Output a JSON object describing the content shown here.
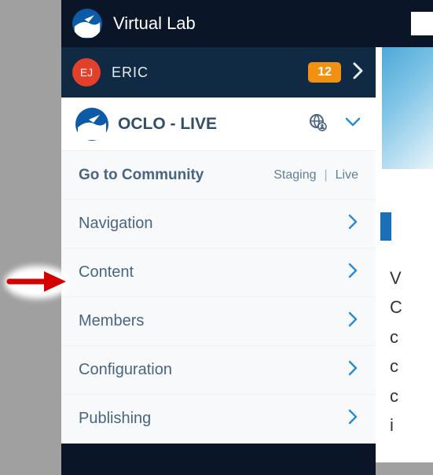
{
  "topbar": {
    "title": "Virtual Lab"
  },
  "user": {
    "initials": "EJ",
    "name": "ERIC",
    "badge": "12"
  },
  "site": {
    "name": "OCLO - LIVE"
  },
  "community": {
    "label": "Go to Community",
    "staging": "Staging",
    "live": "Live"
  },
  "menu": {
    "navigation": "Navigation",
    "content": "Content",
    "members": "Members",
    "configuration": "Configuration",
    "publishing": "Publishing"
  },
  "peek": {
    "lines": "V\nC\nc\nc\nc\ni"
  }
}
